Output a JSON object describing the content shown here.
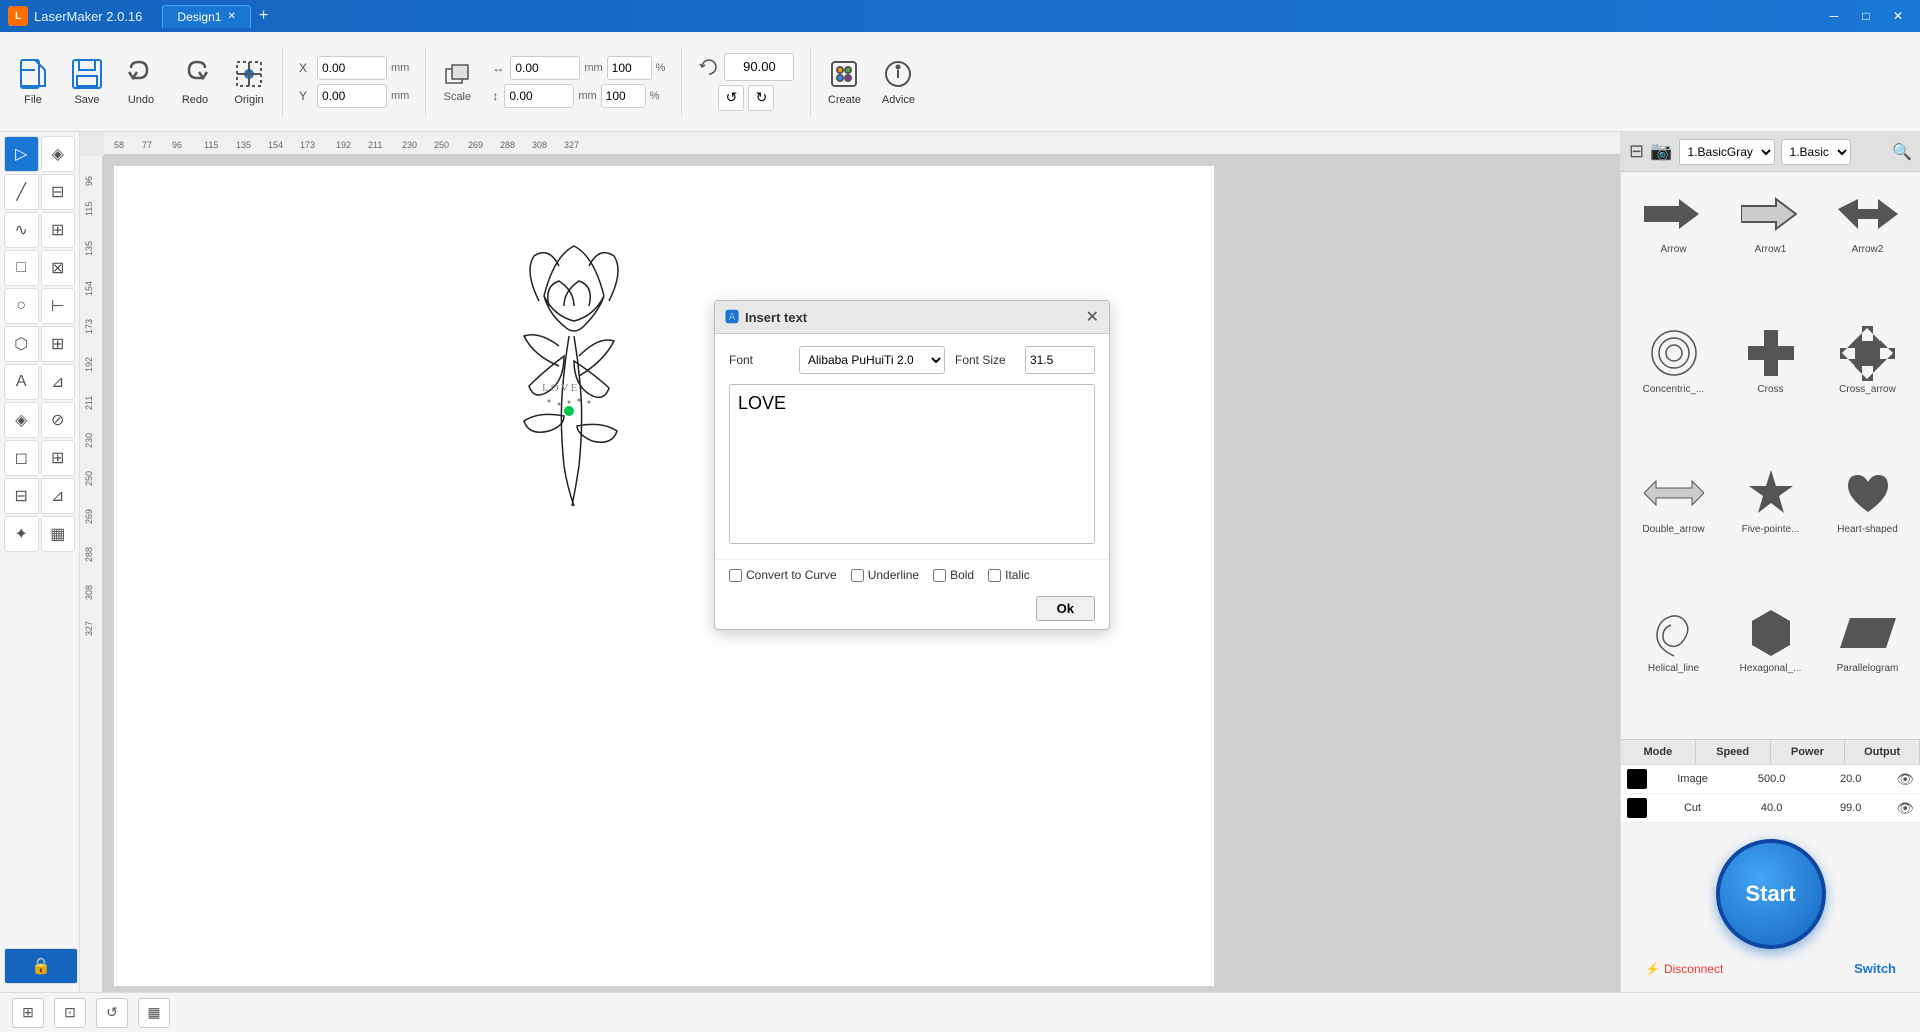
{
  "app": {
    "name": "LaserMaker 2.0.16",
    "tab": "Design1",
    "icon_letter": "L"
  },
  "toolbar": {
    "file_label": "File",
    "save_label": "Save",
    "undo_label": "Undo",
    "redo_label": "Redo",
    "origin_label": "Origin",
    "scale_label": "Scale",
    "create_label": "Create",
    "advice_label": "Advice",
    "x_label": "X",
    "y_label": "Y",
    "x_value": "0.00",
    "y_value": "0.00",
    "x_unit": "mm",
    "y_unit": "mm",
    "w_value": "0.00",
    "h_value": "0.00",
    "w_unit": "mm",
    "h_unit": "mm",
    "w_pct": "100",
    "h_pct": "100",
    "rotation_value": "90.00"
  },
  "dialog": {
    "title": "Insert text",
    "font_label": "Font",
    "font_value": "Alibaba PuHuiTi 2.0",
    "font_size_label": "Font Size",
    "font_size_value": "31.5",
    "text_content": "LOVE",
    "checkbox_curve": "Convert to Curve",
    "checkbox_underline": "Underline",
    "checkbox_bold": "Bold",
    "checkbox_italic": "Italic",
    "ok_label": "Ok",
    "curve_checked": false,
    "underline_checked": false,
    "bold_checked": false,
    "italic_checked": false
  },
  "right_panel": {
    "style_select": "1.BasicGray",
    "material_select": "1.Basic",
    "shapes": [
      {
        "name": "Arrow",
        "shape": "arrow"
      },
      {
        "name": "Arrow1",
        "shape": "arrow1"
      },
      {
        "name": "Arrow2",
        "shape": "arrow2"
      },
      {
        "name": "Concentric_...",
        "shape": "concentric"
      },
      {
        "name": "Cross",
        "shape": "cross"
      },
      {
        "name": "Cross_arrow",
        "shape": "cross_arrow"
      },
      {
        "name": "Double_arrow",
        "shape": "double_arrow"
      },
      {
        "name": "Five-pointe...",
        "shape": "star5"
      },
      {
        "name": "Heart-shaped",
        "shape": "heart"
      },
      {
        "name": "Helical_line",
        "shape": "helical"
      },
      {
        "name": "Hexagonal_...",
        "shape": "hexagon"
      },
      {
        "name": "Parallelogram",
        "shape": "parallelogram"
      }
    ],
    "layers": {
      "header": [
        "Mode",
        "Speed",
        "Power",
        "Output"
      ],
      "rows": [
        {
          "color": "#000000",
          "name": "Image",
          "speed": "500.0",
          "power": "20.0",
          "visible": true
        },
        {
          "color": "#000000",
          "name": "Cut",
          "speed": "40.0",
          "power": "99.0",
          "visible": true
        }
      ]
    },
    "start_label": "Start",
    "disconnect_label": "Disconnect",
    "switch_label": "Switch"
  },
  "statusbar": {
    "tools": [
      "⊞",
      "⊡",
      "↺",
      "▦"
    ]
  }
}
